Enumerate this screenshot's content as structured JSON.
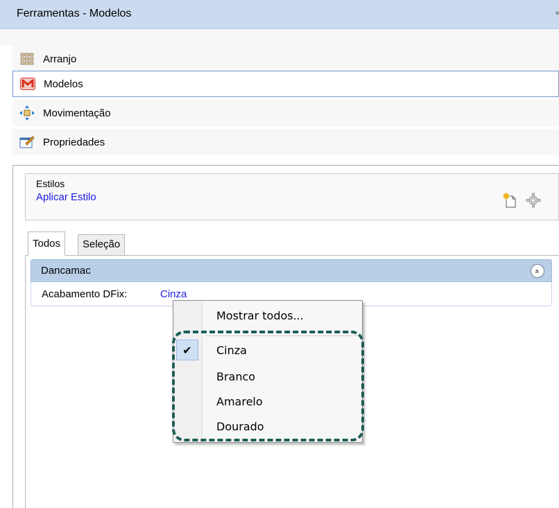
{
  "window": {
    "title": "Ferramentas - Modelos",
    "pin_glyph": "↔"
  },
  "nav": [
    {
      "label": "Arranjo",
      "icon": "grid-icon"
    },
    {
      "label": "Modelos",
      "icon": "models-m-icon",
      "selected": true
    },
    {
      "label": "Movimentação",
      "icon": "move-arrows-icon"
    },
    {
      "label": "Propriedades",
      "icon": "properties-icon"
    }
  ],
  "styles": {
    "group_title": "Estilos",
    "apply_link": "Aplicar Estilo"
  },
  "tabs": [
    "Todos",
    "Seleção"
  ],
  "group": {
    "title": "Dancamac",
    "collapse_glyph": "»"
  },
  "property": {
    "label": "Acabamento DFix:",
    "value": "Cinza"
  },
  "menu": {
    "show_all": "Mostrar todos...",
    "options": [
      {
        "label": "Cinza",
        "checked": true
      },
      {
        "label": "Branco",
        "checked": false
      },
      {
        "label": "Amarelo",
        "checked": false
      },
      {
        "label": "Dourado",
        "checked": false
      }
    ],
    "check_glyph": "✔"
  },
  "colors": {
    "accent_link": "#1a1ae6",
    "highlight": "#1d5f57",
    "header": "#b9cfe8"
  }
}
